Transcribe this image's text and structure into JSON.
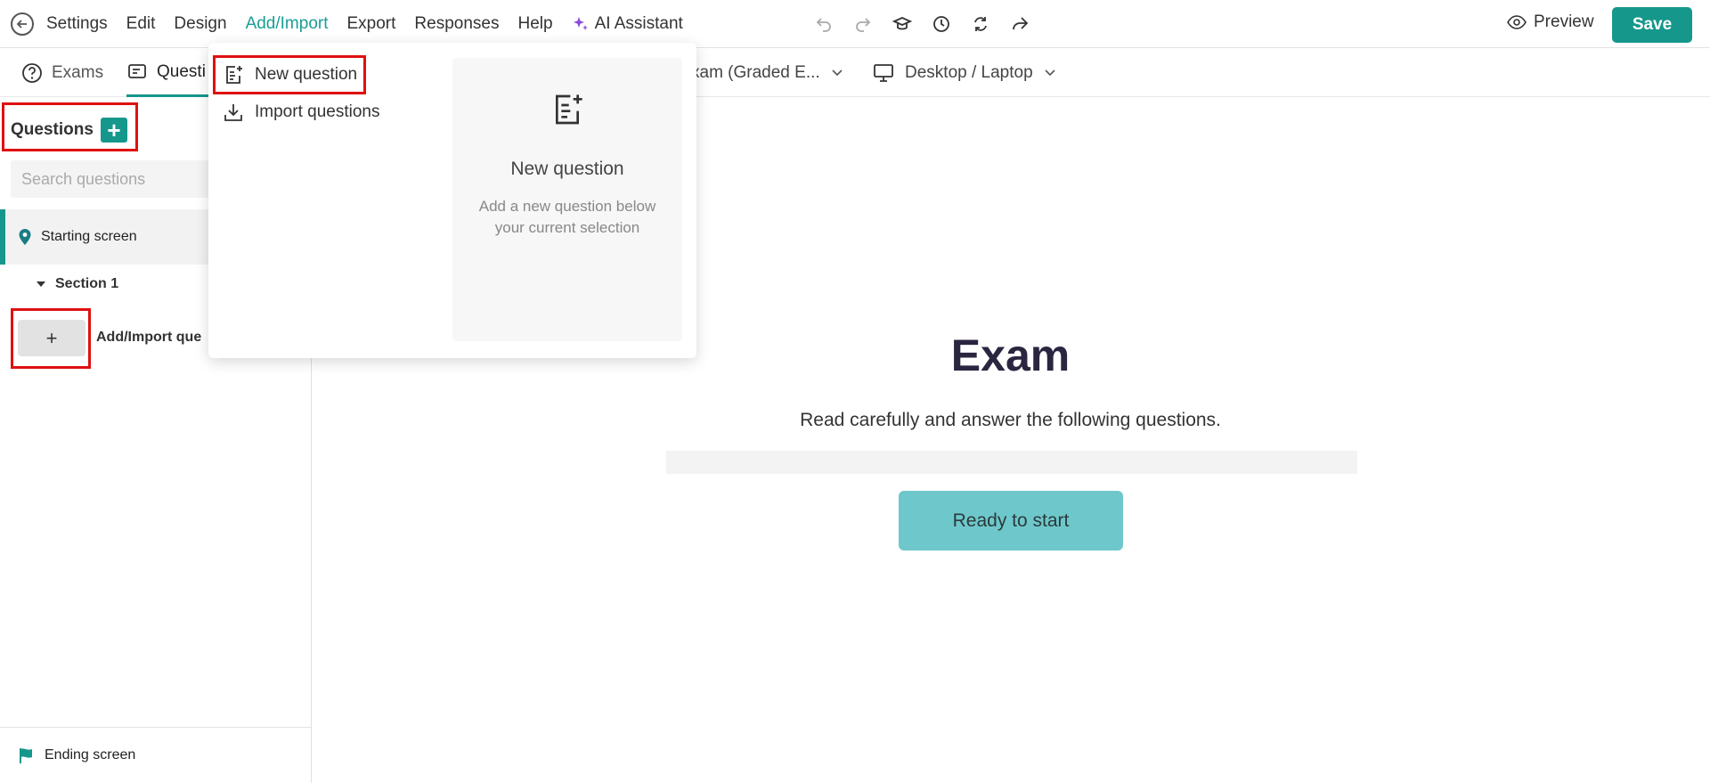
{
  "menu": {
    "items": [
      "Settings",
      "Edit",
      "Design",
      "Add/Import",
      "Export",
      "Responses",
      "Help"
    ],
    "ai_label": "AI Assistant",
    "active_index": 3
  },
  "toolbar": {
    "icons": [
      "undo-icon",
      "redo-icon",
      "graduation-cap-icon",
      "clock-icon",
      "refresh-icon",
      "share-icon"
    ],
    "preview_label": "Preview",
    "save_label": "Save"
  },
  "subbar": {
    "tabs": [
      "Exams",
      "Questi"
    ],
    "active_tab": "Questi",
    "mode_select": "xam (Graded E...",
    "device_select": "Desktop / Laptop"
  },
  "sidebar": {
    "questions_title": "Questions",
    "search_placeholder": "Search questions",
    "starting_screen": "Starting screen",
    "section_label": "Section 1",
    "add_button": "+",
    "add_label": "Add/Import que",
    "ending_screen": "Ending screen"
  },
  "dropdown": {
    "new_question": "New question",
    "import_questions": "Import questions",
    "preview_title": "New question",
    "preview_desc": "Add a new question below your current selection"
  },
  "canvas": {
    "title": "Exam",
    "subtitle": "Read carefully and answer the following questions.",
    "start_button": "Ready to start"
  },
  "colors": {
    "accent": "#16978c",
    "start_button": "#6ec8cb",
    "highlight": "#e01010",
    "ai": "#8a4bd8"
  }
}
